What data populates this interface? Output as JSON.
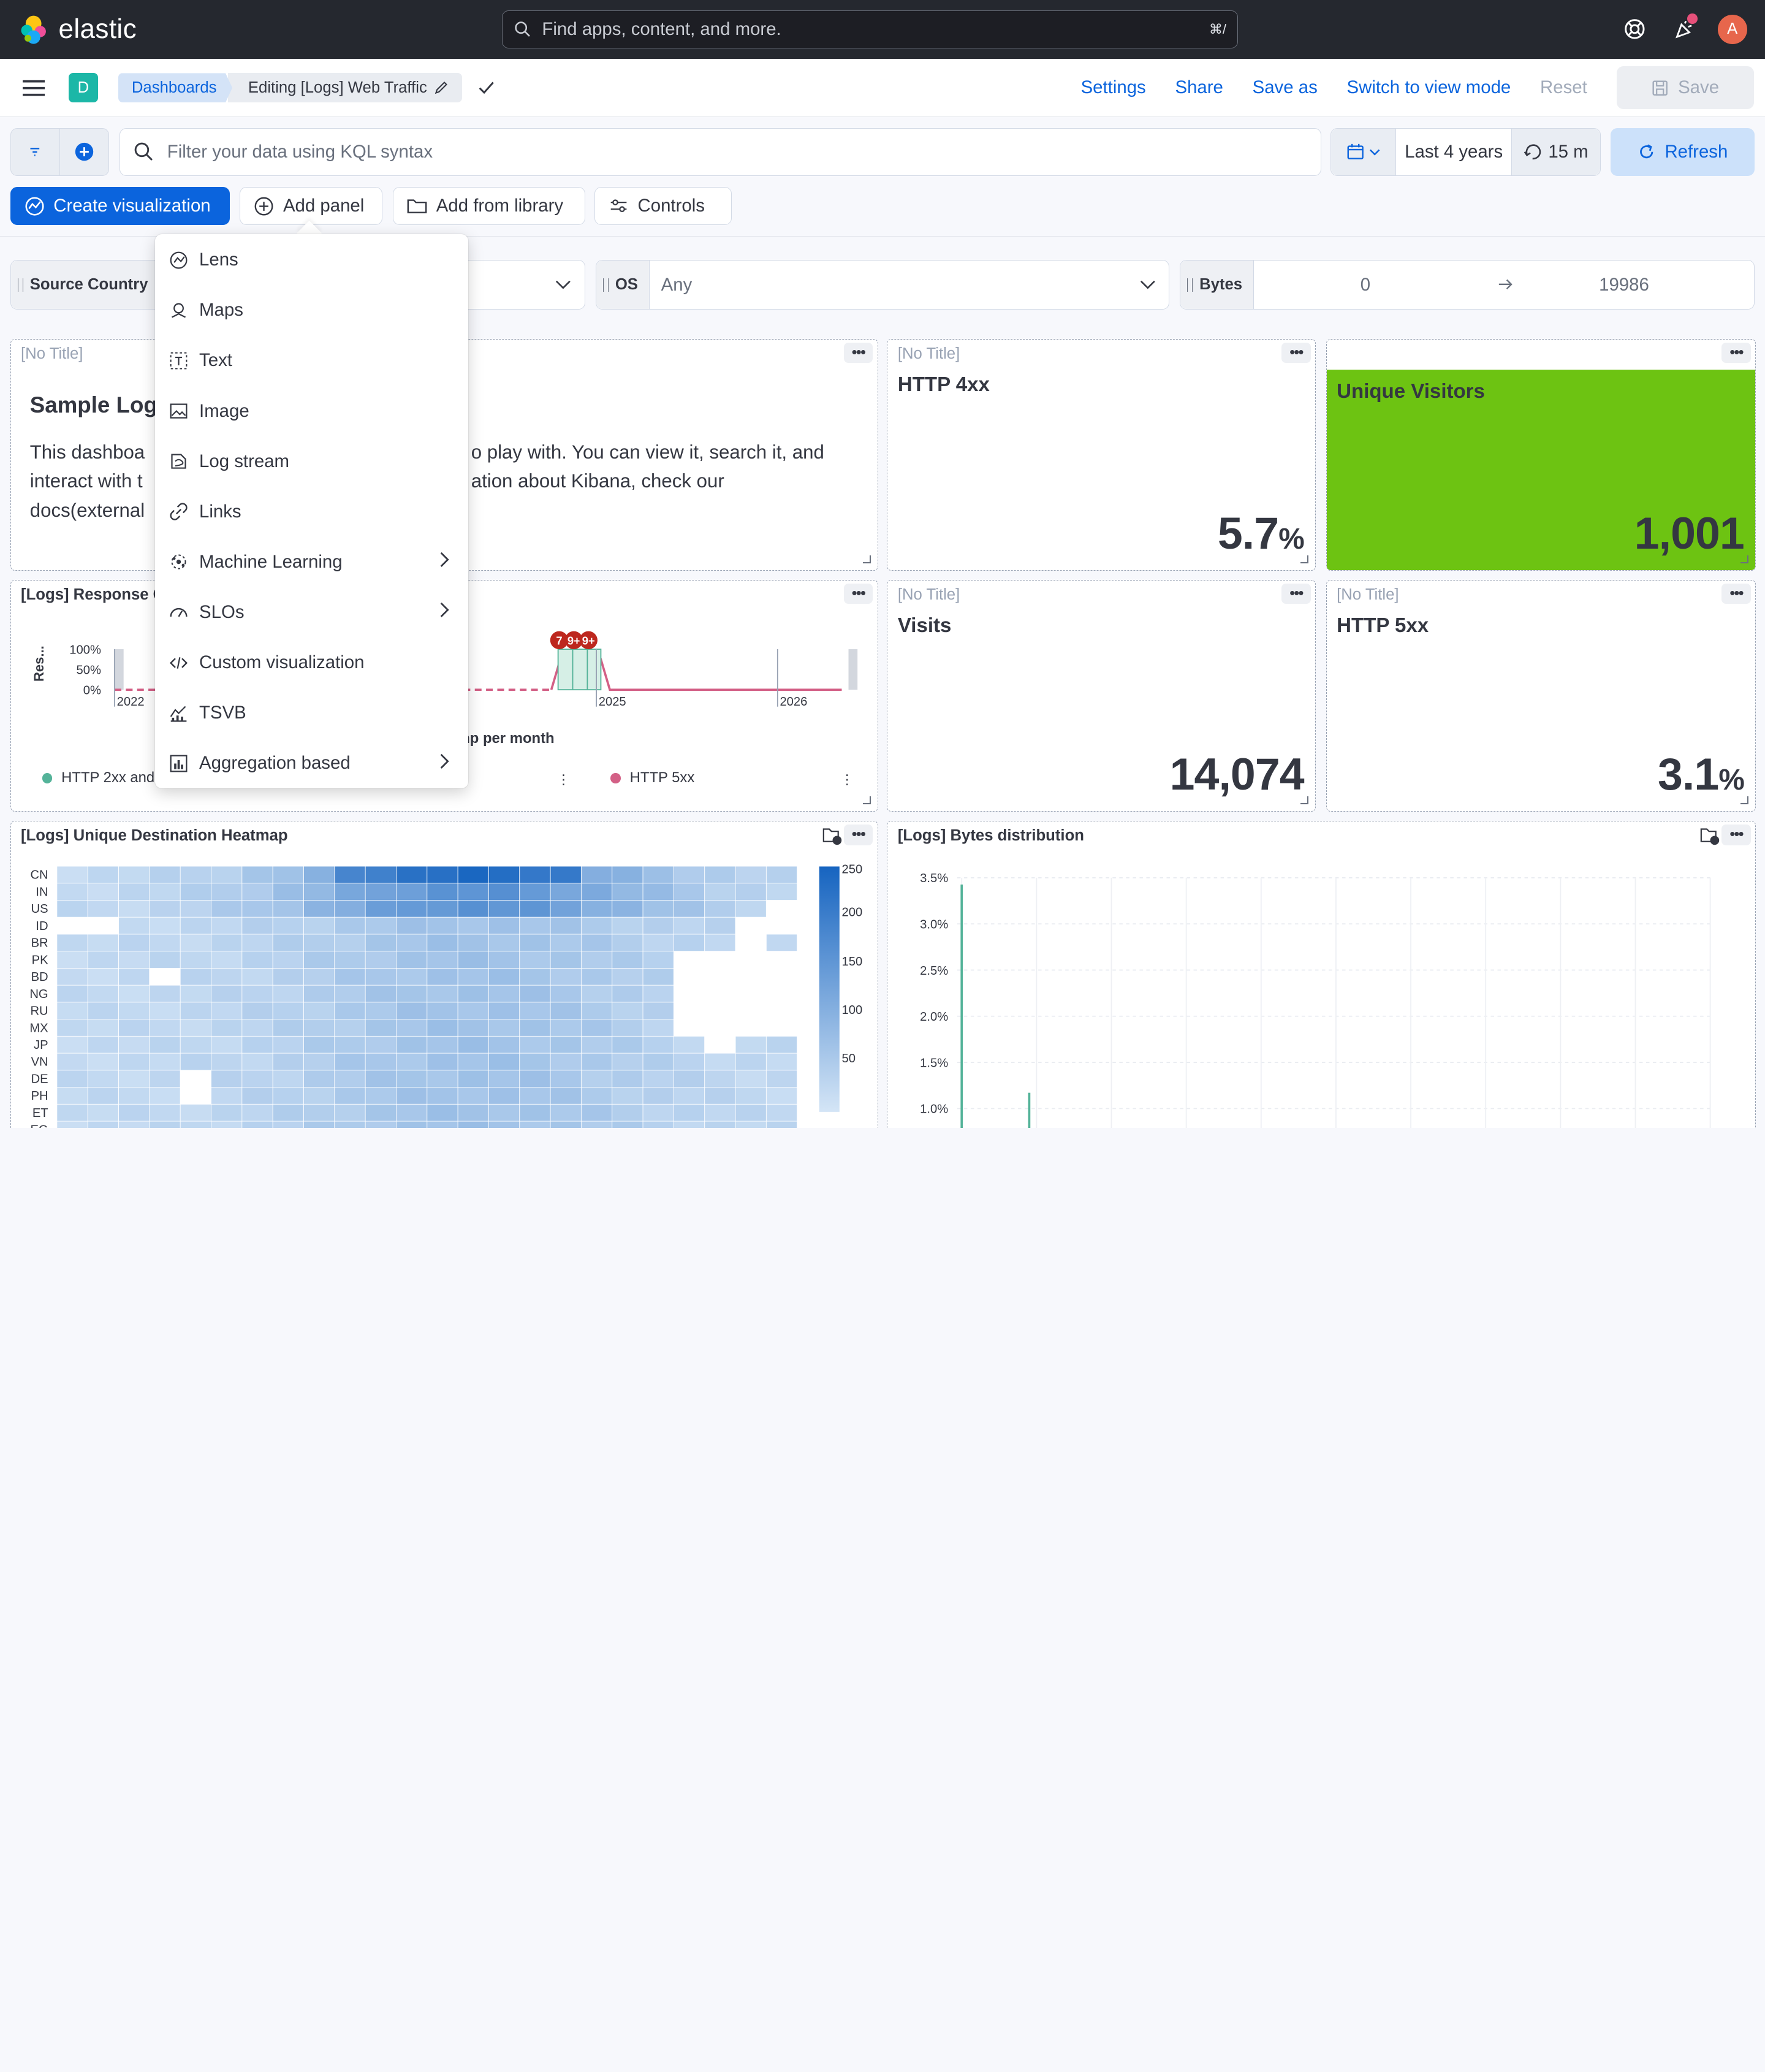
{
  "header": {
    "logo_text": "elastic",
    "search_placeholder": "Find apps, content, and more.",
    "search_shortcut": "⌘/",
    "avatar_initial": "A"
  },
  "subheader": {
    "space_initial": "D",
    "breadcrumb_root": "Dashboards",
    "breadcrumb_current": "Editing [Logs] Web Traffic",
    "links": {
      "settings": "Settings",
      "share": "Share",
      "save_as": "Save as",
      "switch_mode": "Switch to view mode",
      "reset": "Reset",
      "save": "Save"
    }
  },
  "query": {
    "placeholder": "Filter your data using KQL syntax",
    "time_range": "Last 4 years",
    "auto_refresh": "15 m",
    "refresh_label": "Refresh"
  },
  "toolbar": {
    "create_viz": "Create visualization",
    "add_panel": "Add panel",
    "add_library": "Add from library",
    "controls": "Controls"
  },
  "controls": {
    "source_country": "Source Country",
    "os_label": "OS",
    "os_value": "Any",
    "bytes_label": "Bytes",
    "bytes_min": "0",
    "bytes_max": "19986"
  },
  "menu": {
    "items": [
      {
        "label": "Lens",
        "icon": "lens-icon"
      },
      {
        "label": "Maps",
        "icon": "maps-icon"
      },
      {
        "label": "Text",
        "icon": "text-icon"
      },
      {
        "label": "Image",
        "icon": "image-icon"
      },
      {
        "label": "Log stream",
        "icon": "log-stream-icon"
      },
      {
        "label": "Links",
        "icon": "link-icon"
      },
      {
        "label": "Machine Learning",
        "icon": "machine-learning-icon"
      },
      {
        "label": "SLOs",
        "icon": "slo-icon"
      },
      {
        "label": "Custom visualization",
        "icon": "code-icon"
      },
      {
        "label": "TSVB",
        "icon": "tsvb-icon"
      },
      {
        "label": "Aggregation based",
        "icon": "aggregation-icon"
      }
    ]
  },
  "panels": {
    "markdown": {
      "title": "[No Title]",
      "heading": "Sample Log",
      "line1a": "This dashboa",
      "line1b": "o play with. You can view it, search it, and",
      "line2a": "interact with t",
      "line2b": "ation about Kibana, check our",
      "line3": "docs(external"
    },
    "http4xx": {
      "title": "[No Title]",
      "label": "HTTP 4xx",
      "value": "5.7",
      "unit": "%"
    },
    "unique": {
      "label": "Unique Visitors",
      "value": "1,001",
      "bg": "#54b399"
    },
    "response": {
      "title": "[Logs] Response C",
      "ylabel": "Res...",
      "xsub": "np per month",
      "legend1": "HTTP 2xx and",
      "legend2": "HTTP 5xx",
      "badges": [
        "7",
        "9+",
        "9+"
      ]
    },
    "visits": {
      "title": "[No Title]",
      "label": "Visits",
      "value": "14,074"
    },
    "http5xx": {
      "title": "[No Title]",
      "label": "HTTP 5xx",
      "value": "3.1",
      "unit": "%"
    },
    "heatmap": {
      "title": "[Logs] Unique Destination Heatmap",
      "rows": [
        "CN",
        "IN",
        "US",
        "ID",
        "BR",
        "PK",
        "BD",
        "NG",
        "RU",
        "MX",
        "JP",
        "VN",
        "DE",
        "PH",
        "ET",
        "EG"
      ],
      "scale": [
        "250",
        "200",
        "150",
        "100",
        "50"
      ]
    },
    "bytes": {
      "title": "[Logs] Bytes distribution",
      "yticks": [
        "3.5%",
        "3.0%",
        "2.5%",
        "2.0%",
        "1.5%",
        "1.0%"
      ]
    }
  },
  "chart_data": [
    {
      "type": "line",
      "title": "[Logs] Response C",
      "ylabel": "Res...",
      "x": [
        "2022",
        "2025",
        "2026"
      ],
      "yticks": [
        "100%",
        "50%",
        "0%"
      ],
      "series": [
        {
          "name": "HTTP 2xx and",
          "color": "#54b399"
        },
        {
          "name": "HTTP 5xx",
          "color": "#d36086"
        }
      ]
    },
    {
      "type": "heatmap",
      "title": "[Logs] Unique Destination Heatmap",
      "y": [
        "CN",
        "IN",
        "US",
        "ID",
        "BR",
        "PK",
        "BD",
        "NG",
        "RU",
        "MX",
        "JP",
        "VN",
        "DE",
        "PH",
        "ET",
        "EG"
      ],
      "legend": [
        "250",
        "200",
        "150",
        "100",
        "50"
      ]
    },
    {
      "type": "bar",
      "title": "[Logs] Bytes distribution",
      "yticks": [
        "3.5%",
        "3.0%",
        "2.5%",
        "2.0%",
        "1.5%",
        "1.0%"
      ]
    }
  ],
  "colors": {
    "primary": "#0b64dd",
    "header_bg": "#25282f",
    "unique_visitors_bg": "#6dc312",
    "heatmap_high": "#1664c0",
    "heatmap_low": "#d4e5f6"
  }
}
